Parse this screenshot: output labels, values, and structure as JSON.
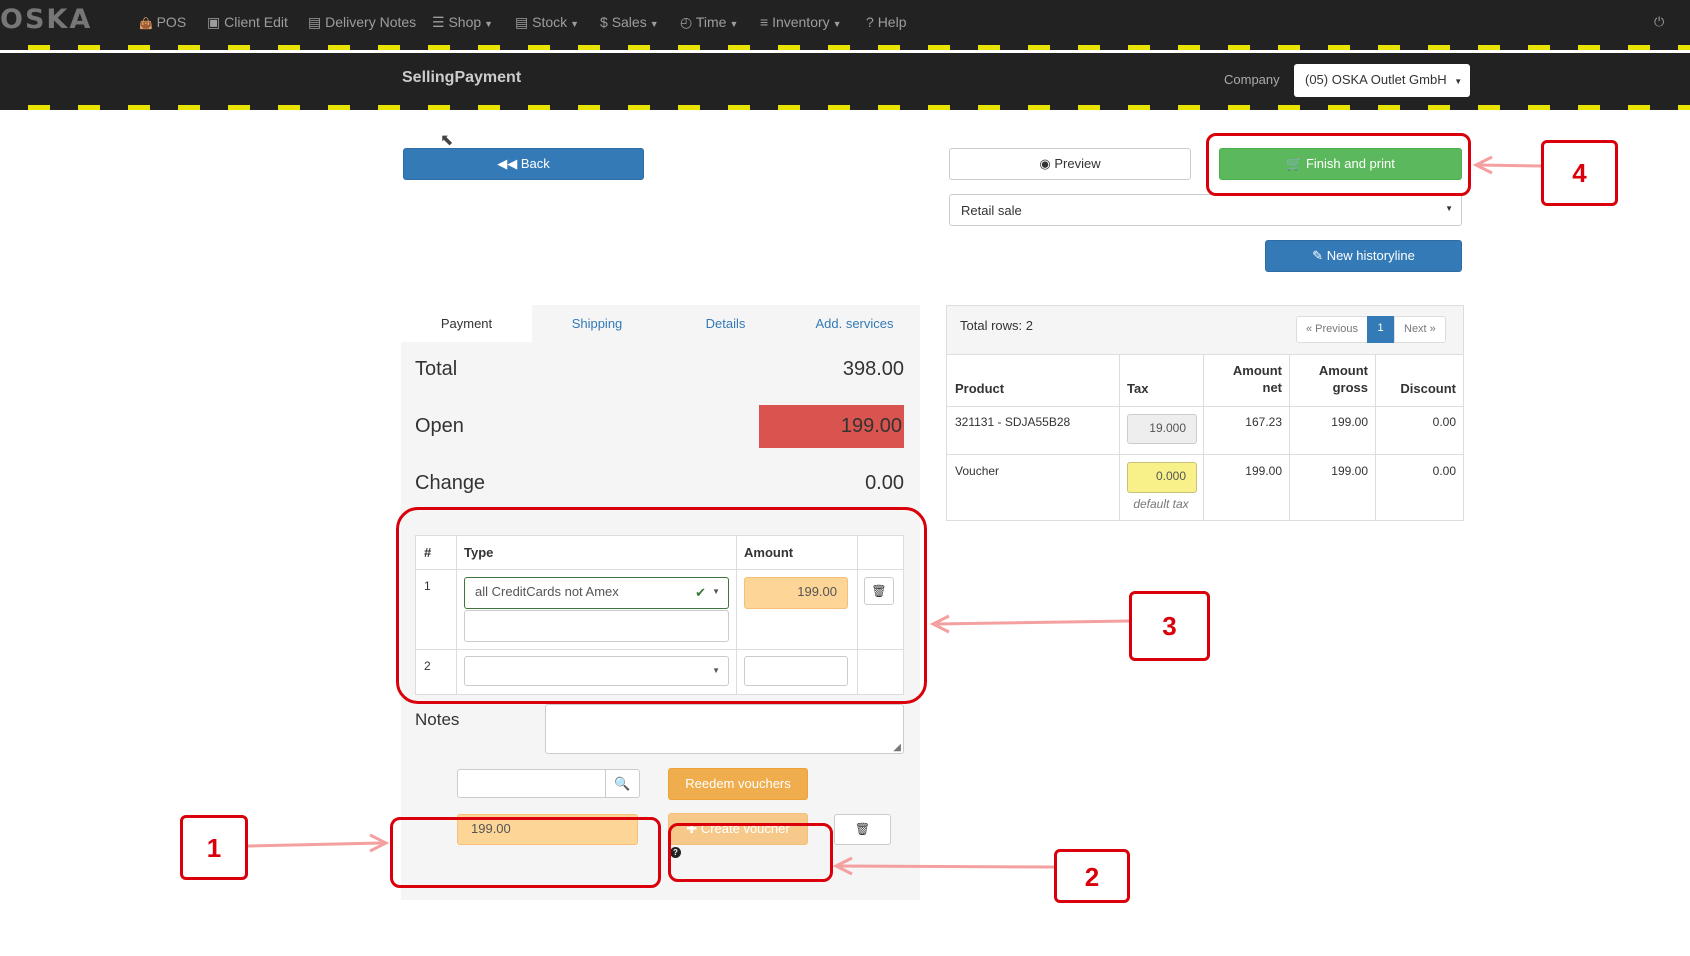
{
  "nav": {
    "logo": "OSKA",
    "items": [
      {
        "label": "POS",
        "icon": "shopping-bag-icon",
        "glyph": "👜"
      },
      {
        "label": "Client Edit",
        "icon": "contact-card-icon",
        "glyph": "▣"
      },
      {
        "label": "Delivery Notes",
        "icon": "box-icon",
        "glyph": "▤"
      },
      {
        "label": "Shop",
        "icon": "sliders-icon",
        "glyph": "☰"
      },
      {
        "label": "Stock",
        "icon": "archive-icon",
        "glyph": "▤"
      },
      {
        "label": "Sales",
        "icon": "dollar-icon",
        "glyph": "$"
      },
      {
        "label": "Time",
        "icon": "clock-icon",
        "glyph": "◴"
      },
      {
        "label": "Inventory",
        "icon": "list-icon",
        "glyph": "≡"
      },
      {
        "label": "Help",
        "icon": "question-icon",
        "glyph": "?"
      }
    ],
    "power_icon": "power-icon"
  },
  "titlebar": {
    "title": "SellingPayment",
    "company_label": "Company",
    "company_value": "(05) OSKA Outlet GmbH"
  },
  "toolbar": {
    "back_label": "Back",
    "preview_label": "Preview",
    "finish_label": "Finish and print",
    "sale_type": "Retail sale",
    "new_history_label": "New historyline"
  },
  "tabs": [
    "Payment",
    "Shipping",
    "Details",
    "Add. services"
  ],
  "totals": {
    "total_label": "Total",
    "total_value": "398.00",
    "open_label": "Open",
    "open_value": "199.00",
    "change_label": "Change",
    "change_value": "0.00"
  },
  "payments": {
    "headers": [
      "#",
      "Type",
      "Amount"
    ],
    "rows": [
      {
        "num": "1",
        "type": "all CreditCards not Amex",
        "amount": "199.00"
      },
      {
        "num": "2",
        "type": "",
        "amount": ""
      }
    ]
  },
  "notes_label": "Notes",
  "voucher": {
    "search_value": "",
    "redeem_label": "Reedem vouchers",
    "amount": "199.00",
    "create_label": "Create voucher"
  },
  "products": {
    "total_rows": "Total rows: 2",
    "pagination": {
      "prev": "« Previous",
      "current": "1",
      "next": "Next »"
    },
    "headers": {
      "product": "Product",
      "tax": "Tax",
      "net1": "Amount",
      "net2": "net",
      "gross1": "Amount",
      "gross2": "gross",
      "discount": "Discount"
    },
    "rows": [
      {
        "product": "321131 - SDJA55B28",
        "tax": "19.000",
        "net": "167.23",
        "gross": "199.00",
        "discount": "0.00",
        "note": ""
      },
      {
        "product": "Voucher",
        "tax": "0.000",
        "net": "199.00",
        "gross": "199.00",
        "discount": "0.00",
        "note": "default tax"
      }
    ]
  },
  "annotations": [
    "1",
    "2",
    "3",
    "4"
  ],
  "colors": {
    "annotation_red": "#d9000b",
    "primary": "#337ab7",
    "success": "#5cb85c",
    "warning": "#f0ad4e",
    "open_bg": "#d9534f"
  }
}
